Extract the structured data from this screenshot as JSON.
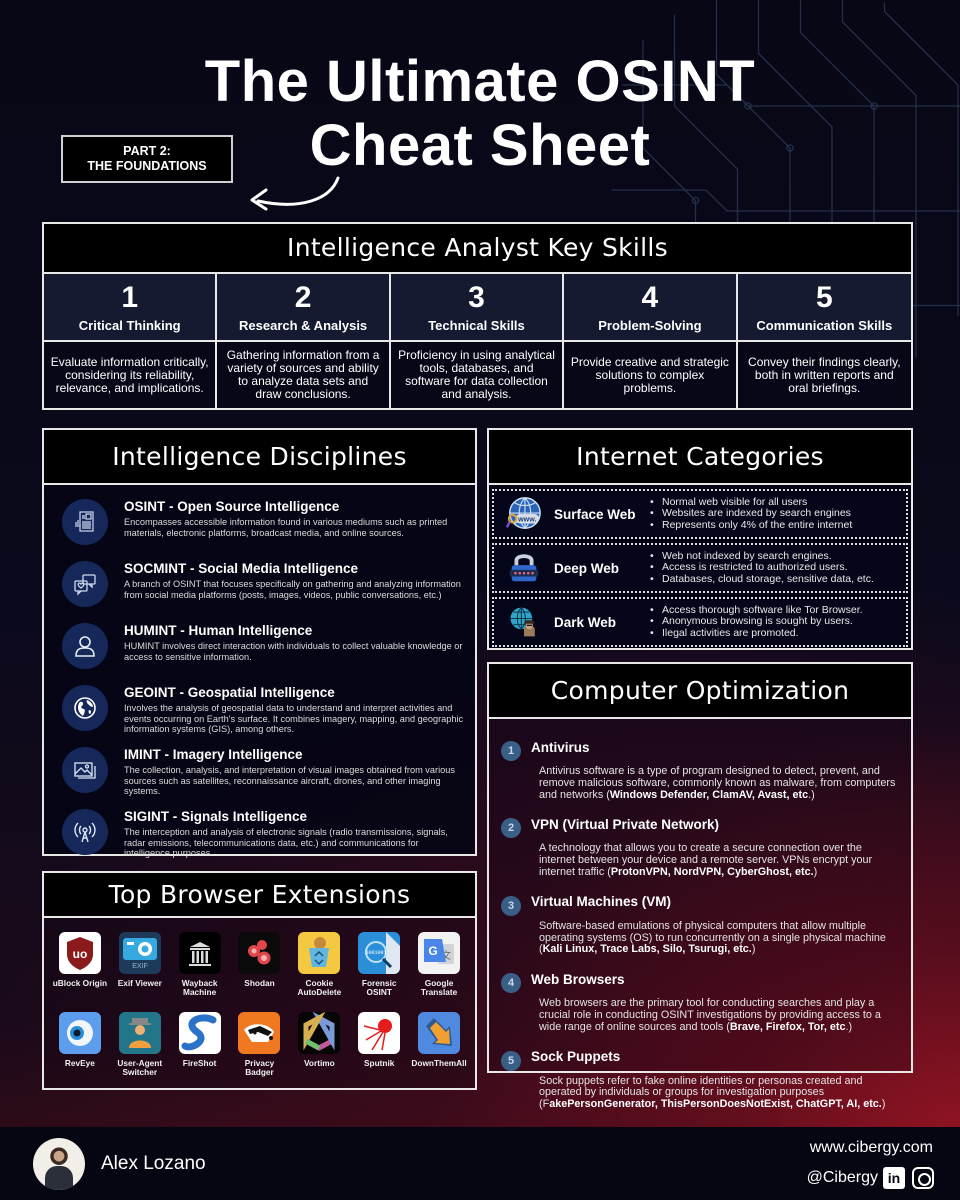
{
  "header": {
    "title_line1": "The Ultimate OSINT",
    "title_line2": "Cheat Sheet",
    "part_line1": "PART 2:",
    "part_line2": "THE FOUNDATIONS"
  },
  "skills": {
    "title": "Intelligence Analyst Key Skills",
    "items": [
      {
        "num": "1",
        "name": "Critical Thinking",
        "desc": "Evaluate information critically, considering its reliability, relevance, and implications."
      },
      {
        "num": "2",
        "name": "Research & Analysis",
        "desc": "Gathering information from a variety of sources and ability to analyze data sets and draw  conclusions."
      },
      {
        "num": "3",
        "name": "Technical Skills",
        "desc": "Proficiency in using analytical tools, databases, and software for data collection and analysis."
      },
      {
        "num": "4",
        "name": "Problem-Solving",
        "desc": "Provide creative and strategic solutions to complex problems."
      },
      {
        "num": "5",
        "name": "Communication Skills",
        "desc": "Convey their findings clearly, both in written reports and oral briefings."
      }
    ]
  },
  "disciplines": {
    "title": "Intelligence Disciplines",
    "items": [
      {
        "icon": "document-chart-icon",
        "title": "OSINT - Open Source Intelligence",
        "desc": "Encompasses accessible information found in various mediums such as printed materials, electronic platforms, broadcast media, and online sources."
      },
      {
        "icon": "social-chat-icon",
        "title": "SOCMINT - Social Media Intelligence",
        "desc": "A branch of OSINT that focuses specifically on gathering and analyzing information from social media platforms (posts, images, videos, public conversations, etc.)"
      },
      {
        "icon": "person-icon",
        "title": "HUMINT - Human Intelligence",
        "desc": "HUMINT involves direct interaction with individuals to collect valuable knowledge or access to sensitive information."
      },
      {
        "icon": "globe-icon",
        "title": "GEOINT - Geospatial Intelligence",
        "desc": "Involves the analysis of geospatial data to understand and interpret activities and events occurring on Earth's surface. It combines imagery, mapping, and geographic information systems (GIS), among others."
      },
      {
        "icon": "image-icon",
        "title": "IMINT - Imagery Intelligence",
        "desc": "The collection, analysis, and interpretation of visual images obtained from various sources such as satellites, reconnaissance aircraft, drones, and other imaging systems."
      },
      {
        "icon": "antenna-icon",
        "title": "SIGINT - Signals Intelligence",
        "desc": "The interception and analysis of electronic signals (radio transmissions, signals, radar emissions, telecommunications data, etc.) and communications for intelligence purposes"
      }
    ]
  },
  "internet": {
    "title": "Internet Categories",
    "items": [
      {
        "icon": "www-globe-icon",
        "name": "Surface Web",
        "bullets": [
          "Normal web visible for all users",
          "Websites are indexed by search engines",
          "Represents only 4% of the entire internet"
        ]
      },
      {
        "icon": "padlock-icon",
        "name": "Deep Web",
        "bullets": [
          "Web not indexed by search engines.",
          "Access is restricted to authorized users.",
          "Databases, cloud storage, sensitive data, etc."
        ]
      },
      {
        "icon": "hacker-globe-icon",
        "name": "Dark Web",
        "bullets": [
          "Access thorough software like Tor Browser.",
          "Anonymous browsing is sought by users.",
          "Ilegal activities are promoted."
        ]
      }
    ]
  },
  "optimization": {
    "title": "Computer Optimization",
    "items": [
      {
        "num": "1",
        "title": "Antivirus",
        "desc": "Antivirus software is a type of program designed to detect, prevent, and remove malicious software, commonly known as malware, from computers and networks (",
        "bold": "Windows Defender, ClamAV, Avast, etc",
        "tail": ".)"
      },
      {
        "num": "2",
        "title": "VPN (Virtual Private Network)",
        "desc": "A technology that allows you to create a secure connection over the internet between your device and a remote server. VPNs encrypt your internet traffic (",
        "bold": "ProtonVPN, NordVPN, CyberGhost, etc.",
        "tail": ")"
      },
      {
        "num": "3",
        "title": "Virtual Machines (VM)",
        "desc": "Software-based emulations of physical computers that allow multiple operating systems (OS) to run concurrently on a single physical machine (",
        "bold": "Kali Linux, Trace Labs, Silo, Tsurugi, etc.",
        "tail": ")"
      },
      {
        "num": "4",
        "title": "Web Browsers",
        "desc": "Web browsers are the primary tool for conducting searches and play a crucial role in conducting OSINT investigations by providing access to a wide range of online sources and tools (",
        "bold": "Brave, Firefox, Tor, etc",
        "tail": ".)"
      },
      {
        "num": "5",
        "title": "Sock Puppets",
        "desc": "Sock puppets refer to fake online identities or personas created and operated by individuals or groups for investigation purposes (F",
        "bold": "akePersonGenerator, ThisPersonDoesNotExist, ChatGPT, AI, etc.",
        "tail": ")"
      }
    ]
  },
  "extensions": {
    "title": "Top Browser Extensions",
    "items": [
      {
        "icon": "ublock-origin-icon",
        "label": "uBlock Origin"
      },
      {
        "icon": "exif-viewer-icon",
        "label": "Exif Viewer"
      },
      {
        "icon": "wayback-machine-icon",
        "label": "Wayback Machine"
      },
      {
        "icon": "shodan-icon",
        "label": "Shodan"
      },
      {
        "icon": "cookie-autodelete-icon",
        "label": "Cookie AutoDelete"
      },
      {
        "icon": "forensic-osint-icon",
        "label": "Forensic OSINT"
      },
      {
        "icon": "google-translate-icon",
        "label": "Google Translate"
      },
      {
        "icon": "reveye-icon",
        "label": "RevEye"
      },
      {
        "icon": "user-agent-switcher-icon",
        "label": "User-Agent Switcher"
      },
      {
        "icon": "fireshot-icon",
        "label": "FireShot"
      },
      {
        "icon": "privacy-badger-icon",
        "label": "Privacy Badger"
      },
      {
        "icon": "vortimo-icon",
        "label": "Vortimo"
      },
      {
        "icon": "sputnik-icon",
        "label": "Sputnik"
      },
      {
        "icon": "downthemall-icon",
        "label": "DownThemAll"
      }
    ]
  },
  "footer": {
    "author": "Alex Lozano",
    "website": "www.cibergy.com",
    "handle": "@Cibergy",
    "linkedin_label": "in"
  },
  "colors": {
    "skill_header_bg": "#161a30",
    "icon_circle": "#16285a",
    "number_badge": "#3a5f86",
    "accent_red": "#961423"
  }
}
